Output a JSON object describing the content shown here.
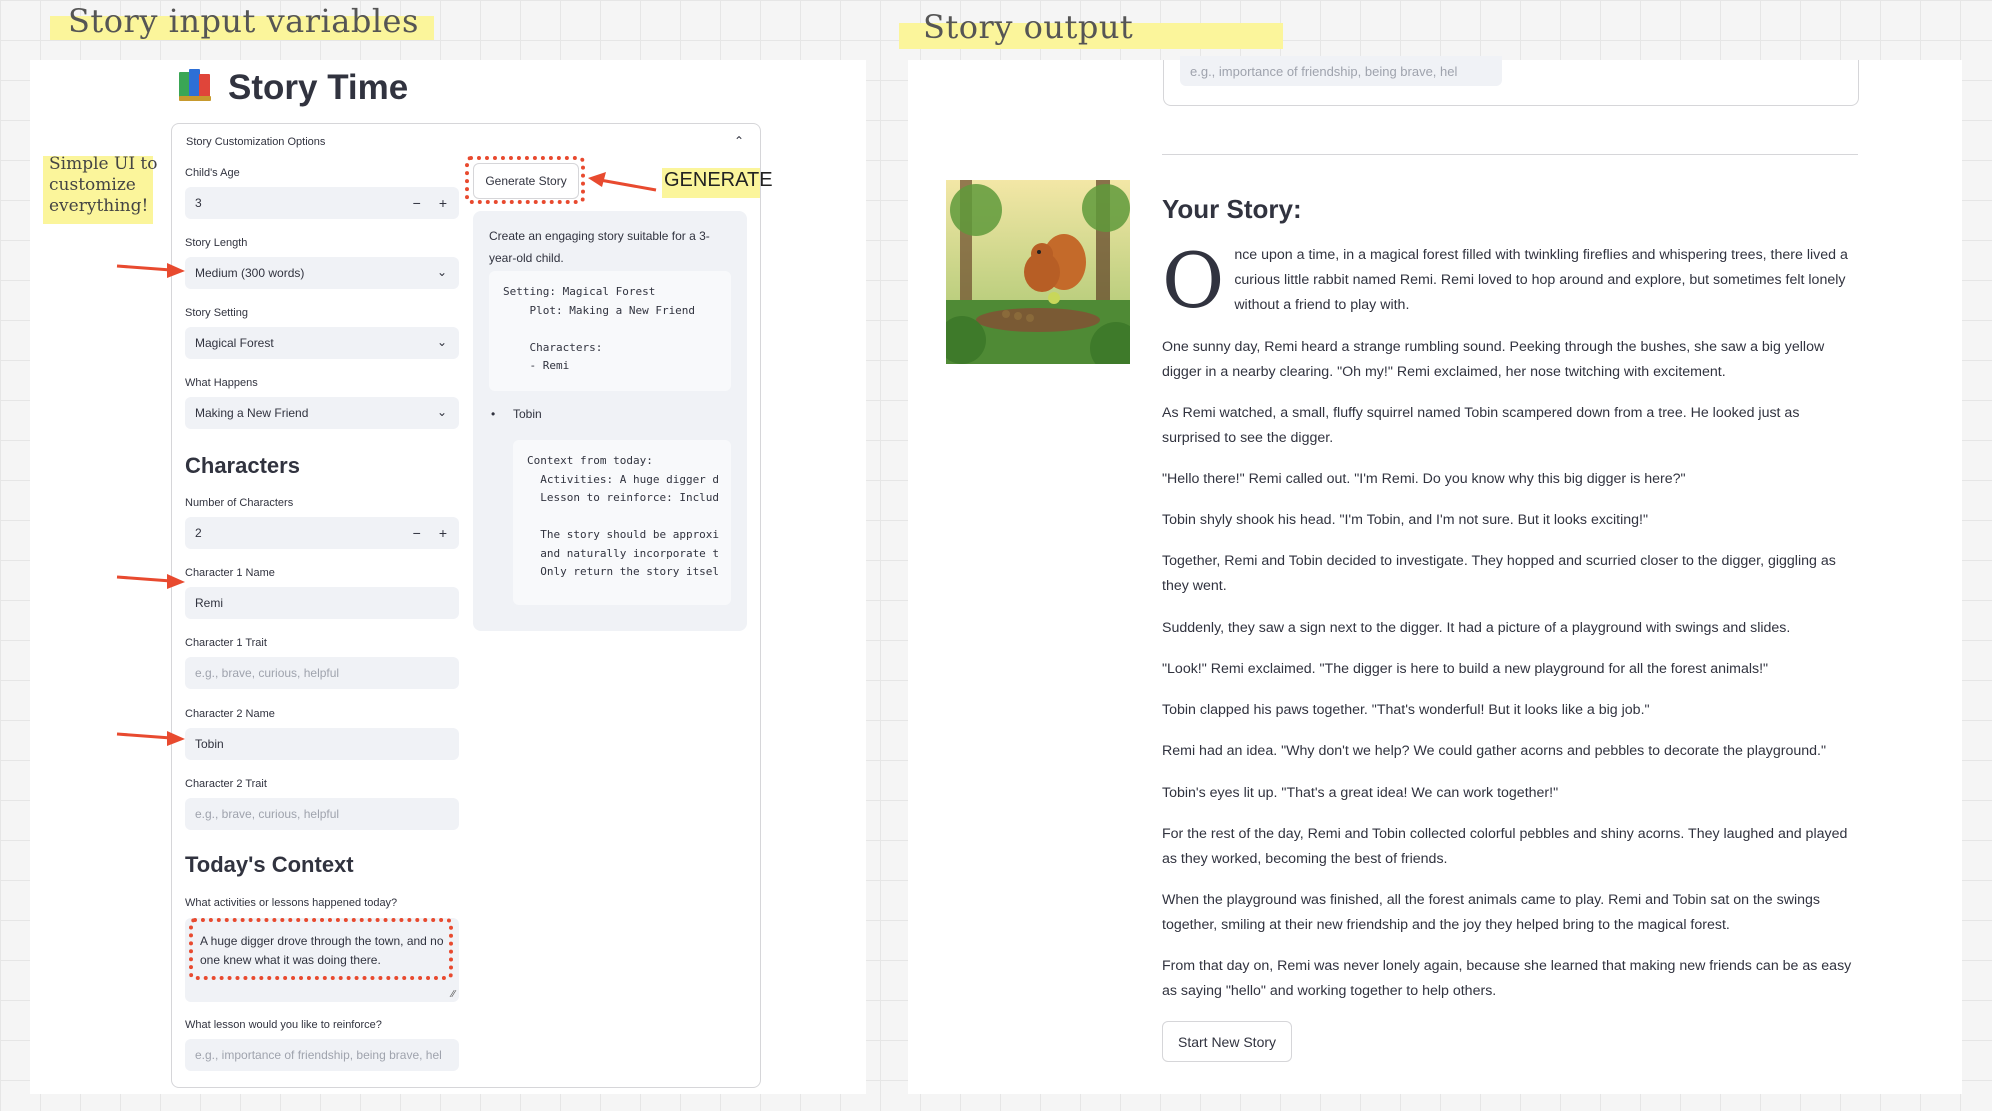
{
  "annotations": {
    "input_label": "Story input variables",
    "output_label": "Story output",
    "simple_ui_note": "Simple UI to customize everything!",
    "generate_note": "GENERATE"
  },
  "app": {
    "title": "Story Time",
    "logo_icon": "books-icon",
    "expander_label": "Story Customization Options",
    "generate_button": "Generate Story",
    "age": {
      "label": "Child's Age",
      "value": "3"
    },
    "length": {
      "label": "Story Length",
      "value": "Medium (300 words)"
    },
    "setting": {
      "label": "Story Setting",
      "value": "Magical Forest"
    },
    "plot": {
      "label": "What Happens",
      "value": "Making a New Friend"
    },
    "characters_heading": "Characters",
    "num_characters": {
      "label": "Number of Characters",
      "value": "2"
    },
    "char1_name": {
      "label": "Character 1 Name",
      "value": "Remi"
    },
    "char1_trait": {
      "label": "Character 1 Trait",
      "placeholder": "e.g., brave, curious, helpful"
    },
    "char2_name": {
      "label": "Character 2 Name",
      "value": "Tobin"
    },
    "char2_trait": {
      "label": "Character 2 Trait",
      "placeholder": "e.g., brave, curious, helpful"
    },
    "context_heading": "Today's Context",
    "activities": {
      "label": "What activities or lessons happened today?",
      "value": "A huge digger drove through the town, and no one knew what it was doing there."
    },
    "lesson": {
      "label": "What lesson would you like to reinforce?",
      "placeholder": "e.g., importance of friendship, being brave, hel"
    },
    "prompt_preview": {
      "intro": "Create an engaging story suitable for a 3-year-old child.",
      "code1": "Setting: Magical Forest\n    Plot: Making a New Friend\n\n    Characters:\n    - Remi",
      "bullet": "Tobin",
      "code2": "Context from today:\n  Activities: A huge digger d\n  Lesson to reinforce: Includ\n\n  The story should be approxi\n  and naturally incorporate t\n  Only return the story itsel"
    }
  },
  "output": {
    "top_placeholder": "e.g., importance of friendship, being brave, hel",
    "heading": "Your Story:",
    "first_letter": "O",
    "paragraphs": [
      "nce upon a time, in a magical forest filled with twinkling fireflies and whispering trees, there lived a curious little rabbit named Remi. Remi loved to hop around and explore, but sometimes felt lonely without a friend to play with.",
      "One sunny day, Remi heard a strange rumbling sound. Peeking through the bushes, she saw a big yellow digger in a nearby clearing. \"Oh my!\" Remi exclaimed, her nose twitching with excitement.",
      "As Remi watched, a small, fluffy squirrel named Tobin scampered down from a tree. He looked just as surprised to see the digger.",
      "\"Hello there!\" Remi called out. \"I'm Remi. Do you know why this big digger is here?\"",
      "Tobin shyly shook his head. \"I'm Tobin, and I'm not sure. But it looks exciting!\"",
      "Together, Remi and Tobin decided to investigate. They hopped and scurried closer to the digger, giggling as they went.",
      "Suddenly, they saw a sign next to the digger. It had a picture of a playground with swings and slides.",
      "\"Look!\" Remi exclaimed. \"The digger is here to build a new playground for all the forest animals!\"",
      "Tobin clapped his paws together. \"That's wonderful! But it looks like a big job.\"",
      "Remi had an idea. \"Why don't we help? We could gather acorns and pebbles to decorate the playground.\"",
      "Tobin's eyes lit up. \"That's a great idea! We can work together!\"",
      "For the rest of the day, Remi and Tobin collected colorful pebbles and shiny acorns. They laughed and played as they worked, becoming the best of friends.",
      "When the playground was finished, all the forest animals came to play. Remi and Tobin sat on the swings together, smiling at their new friendship and the joy they helped bring to the magical forest.",
      "From that day on, Remi was never lonely again, because she learned that making new friends can be as easy as saying \"hello\" and working together to help others."
    ],
    "start_button": "Start New Story"
  }
}
